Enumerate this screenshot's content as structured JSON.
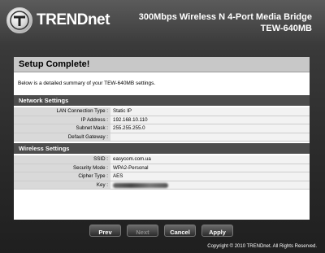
{
  "header": {
    "brand": "TRENDnet",
    "product_line1": "300Mbps Wireless N 4-Port Media Bridge",
    "product_line2": "TEW-640MB",
    "logo_icon": "trendnet-logo-icon"
  },
  "page": {
    "title": "Setup Complete!",
    "summary": "Below is a detailed summary of your TEW-640MB settings."
  },
  "network_settings": {
    "heading": "Network Settings",
    "rows": [
      {
        "label": "LAN Connection Type :",
        "value": "Static IP"
      },
      {
        "label": "IP Address :",
        "value": "192.168.10.110"
      },
      {
        "label": "Subnet Mask :",
        "value": "255.255.255.0"
      },
      {
        "label": "Default Gateway :",
        "value": ""
      }
    ]
  },
  "wireless_settings": {
    "heading": "Wireless Settings",
    "rows": [
      {
        "label": "SSID :",
        "value": "easycom.com.ua"
      },
      {
        "label": "Security Mode :",
        "value": "WPA2-Personal"
      },
      {
        "label": "Cipher Type :",
        "value": "AES"
      },
      {
        "label": "Key :",
        "value": ""
      }
    ]
  },
  "buttons": {
    "prev": "Prev",
    "next": "Next",
    "cancel": "Cancel",
    "apply": "Apply"
  },
  "footer": {
    "copyright": "Copyright © 2010 TRENDnet. All Rights Reserved."
  }
}
